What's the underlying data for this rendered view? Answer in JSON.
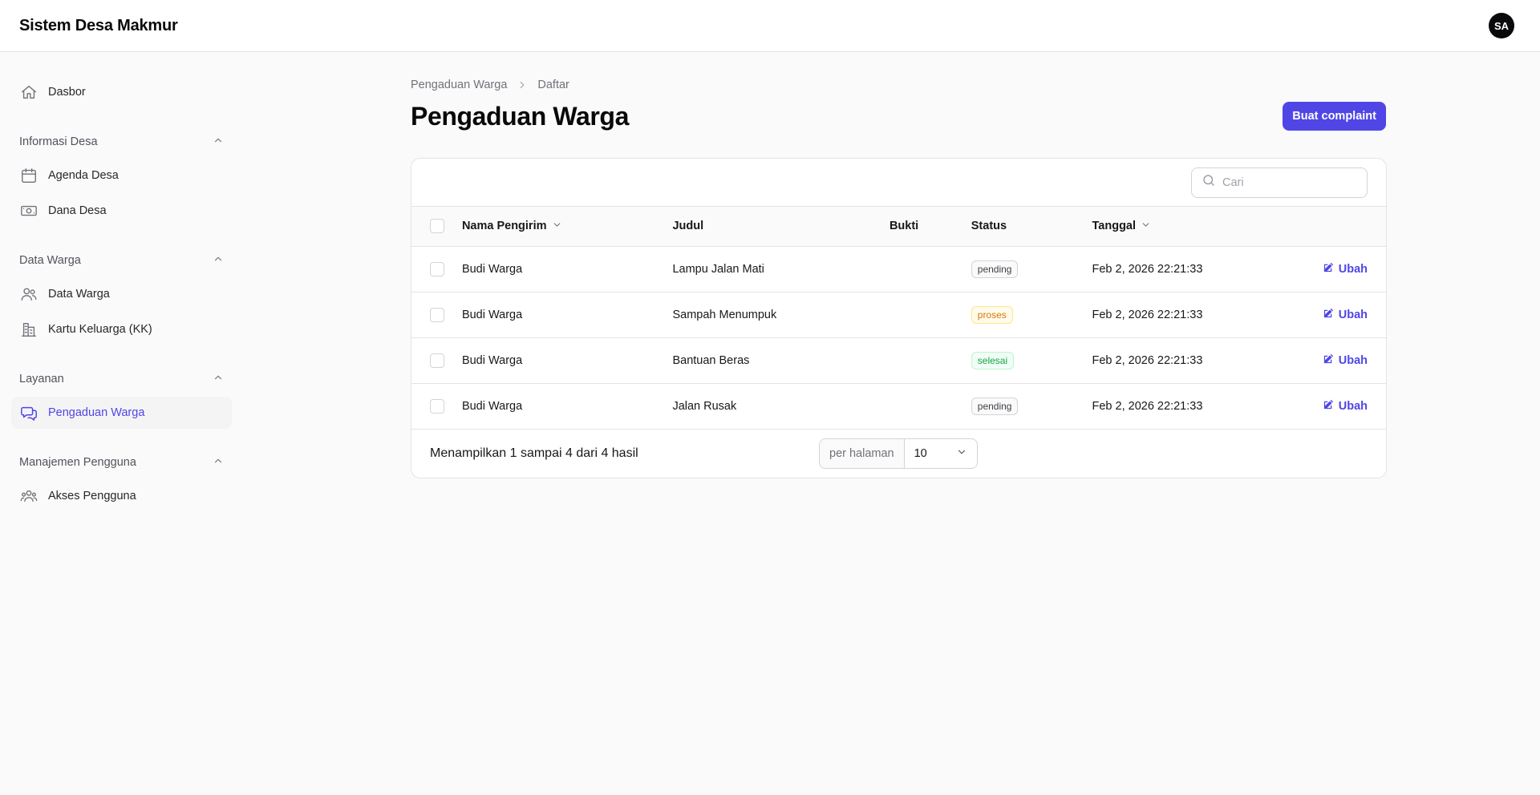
{
  "app": {
    "title": "Sistem Desa Makmur",
    "user_initials": "SA"
  },
  "sidebar": {
    "top_item": {
      "label": "Dasbor",
      "icon": "home-icon"
    },
    "groups": [
      {
        "label": "Informasi Desa",
        "items": [
          {
            "label": "Agenda Desa",
            "icon": "calendar-icon"
          },
          {
            "label": "Dana Desa",
            "icon": "banknotes-icon"
          }
        ]
      },
      {
        "label": "Data Warga",
        "items": [
          {
            "label": "Data Warga",
            "icon": "users-icon"
          },
          {
            "label": "Kartu Keluarga (KK)",
            "icon": "building-icon"
          }
        ]
      },
      {
        "label": "Layanan",
        "items": [
          {
            "label": "Pengaduan Warga",
            "icon": "chat-bubbles-icon",
            "active": true
          }
        ]
      },
      {
        "label": "Manajemen Pengguna",
        "items": [
          {
            "label": "Akses Pengguna",
            "icon": "user-group-icon"
          }
        ]
      }
    ]
  },
  "breadcrumb": {
    "parent": "Pengaduan Warga",
    "current": "Daftar"
  },
  "page": {
    "title": "Pengaduan Warga",
    "create_button": "Buat complaint"
  },
  "table": {
    "search_placeholder": "Cari",
    "columns": {
      "sender": "Nama Pengirim",
      "title": "Judul",
      "proof": "Bukti",
      "status": "Status",
      "date": "Tanggal"
    },
    "edit_label": "Ubah",
    "rows": [
      {
        "sender": "Budi Warga",
        "title": "Lampu Jalan Mati",
        "status": "pending",
        "date": "Feb 2, 2026 22:21:33"
      },
      {
        "sender": "Budi Warga",
        "title": "Sampah Menumpuk",
        "status": "proses",
        "date": "Feb 2, 2026 22:21:33"
      },
      {
        "sender": "Budi Warga",
        "title": "Bantuan Beras",
        "status": "selesai",
        "date": "Feb 2, 2026 22:21:33"
      },
      {
        "sender": "Budi Warga",
        "title": "Jalan Rusak",
        "status": "pending",
        "date": "Feb 2, 2026 22:21:33"
      }
    ],
    "summary": "Menampilkan 1 sampai 4 dari 4 hasil",
    "per_page_label": "per halaman",
    "per_page_value": "10"
  },
  "colors": {
    "accent": "#4f46e5",
    "pending": "#3f3f46",
    "proses": "#d97706",
    "selesai": "#16a34a"
  }
}
